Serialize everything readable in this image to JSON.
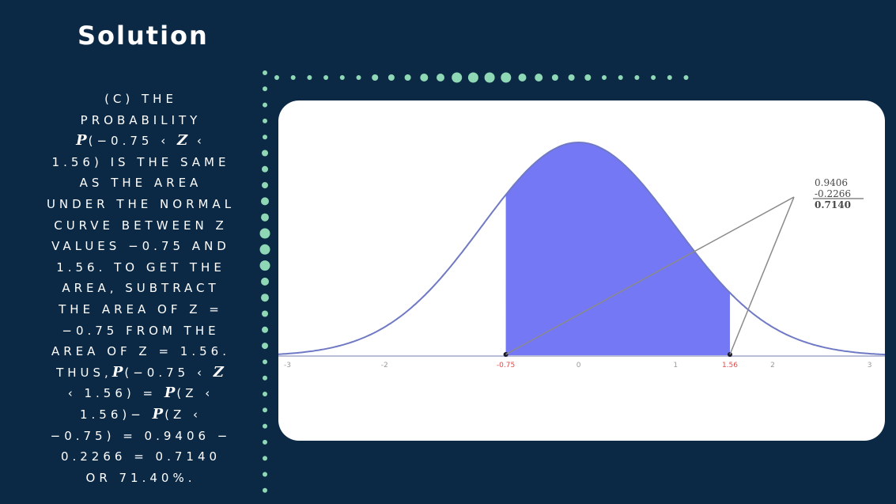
{
  "slide": {
    "title": "Solution",
    "lines": [
      [
        {
          "t": "(c) the"
        }
      ],
      [
        {
          "t": "probability"
        }
      ],
      [
        {
          "t": "P",
          "i": true
        },
        {
          "t": "(−0.75 ‹ "
        },
        {
          "t": "Z",
          "i": true
        },
        {
          "t": " ‹"
        }
      ],
      [
        {
          "t": "1.56) is the same"
        }
      ],
      [
        {
          "t": "as the area"
        }
      ],
      [
        {
          "t": "under the normal"
        }
      ],
      [
        {
          "t": "curve between z"
        }
      ],
      [
        {
          "t": "values −0.75 and"
        }
      ],
      [
        {
          "t": "1.56. to get the"
        }
      ],
      [
        {
          "t": "area, subtract"
        }
      ],
      [
        {
          "t": "the area of z ="
        }
      ],
      [
        {
          "t": "−0.75 from the"
        }
      ],
      [
        {
          "t": "area of z = 1.56."
        }
      ],
      [
        {
          "t": "thus,"
        },
        {
          "t": "P",
          "i": true
        },
        {
          "t": "(−0.75 ‹ "
        },
        {
          "t": "Z",
          "i": true
        }
      ],
      [
        {
          "t": "‹ 1.56) = "
        },
        {
          "t": "P",
          "i": true
        },
        {
          "t": "(Z ‹"
        }
      ],
      [
        {
          "t": "1.56)− "
        },
        {
          "t": "P",
          "i": true
        },
        {
          "t": "(Z ‹"
        }
      ],
      [
        {
          "t": "−0.75) = 0.9406 −"
        }
      ],
      [
        {
          "t": "0.2266 = 0.7140"
        }
      ],
      [
        {
          "t": "or 71.40%."
        }
      ]
    ]
  },
  "figure": {
    "curve_color": "#6f79c4",
    "fill_color": "#7478f4",
    "z_lower": -0.75,
    "z_upper": 1.56,
    "x_range": [
      -3.2,
      3.5
    ],
    "tick_labels": [
      {
        "z": -3,
        "label": "-3"
      },
      {
        "z": -2,
        "label": "-2"
      },
      {
        "z": -0.75,
        "label": "-0.75",
        "red": true
      },
      {
        "z": 0,
        "label": "0"
      },
      {
        "z": 1,
        "label": "1"
      },
      {
        "z": 1.56,
        "label": "1.56",
        "red": true
      },
      {
        "z": 2,
        "label": "2"
      },
      {
        "z": 3,
        "label": "3"
      }
    ],
    "calc": [
      "0.9406",
      "-0.2266",
      "0.7140"
    ]
  }
}
